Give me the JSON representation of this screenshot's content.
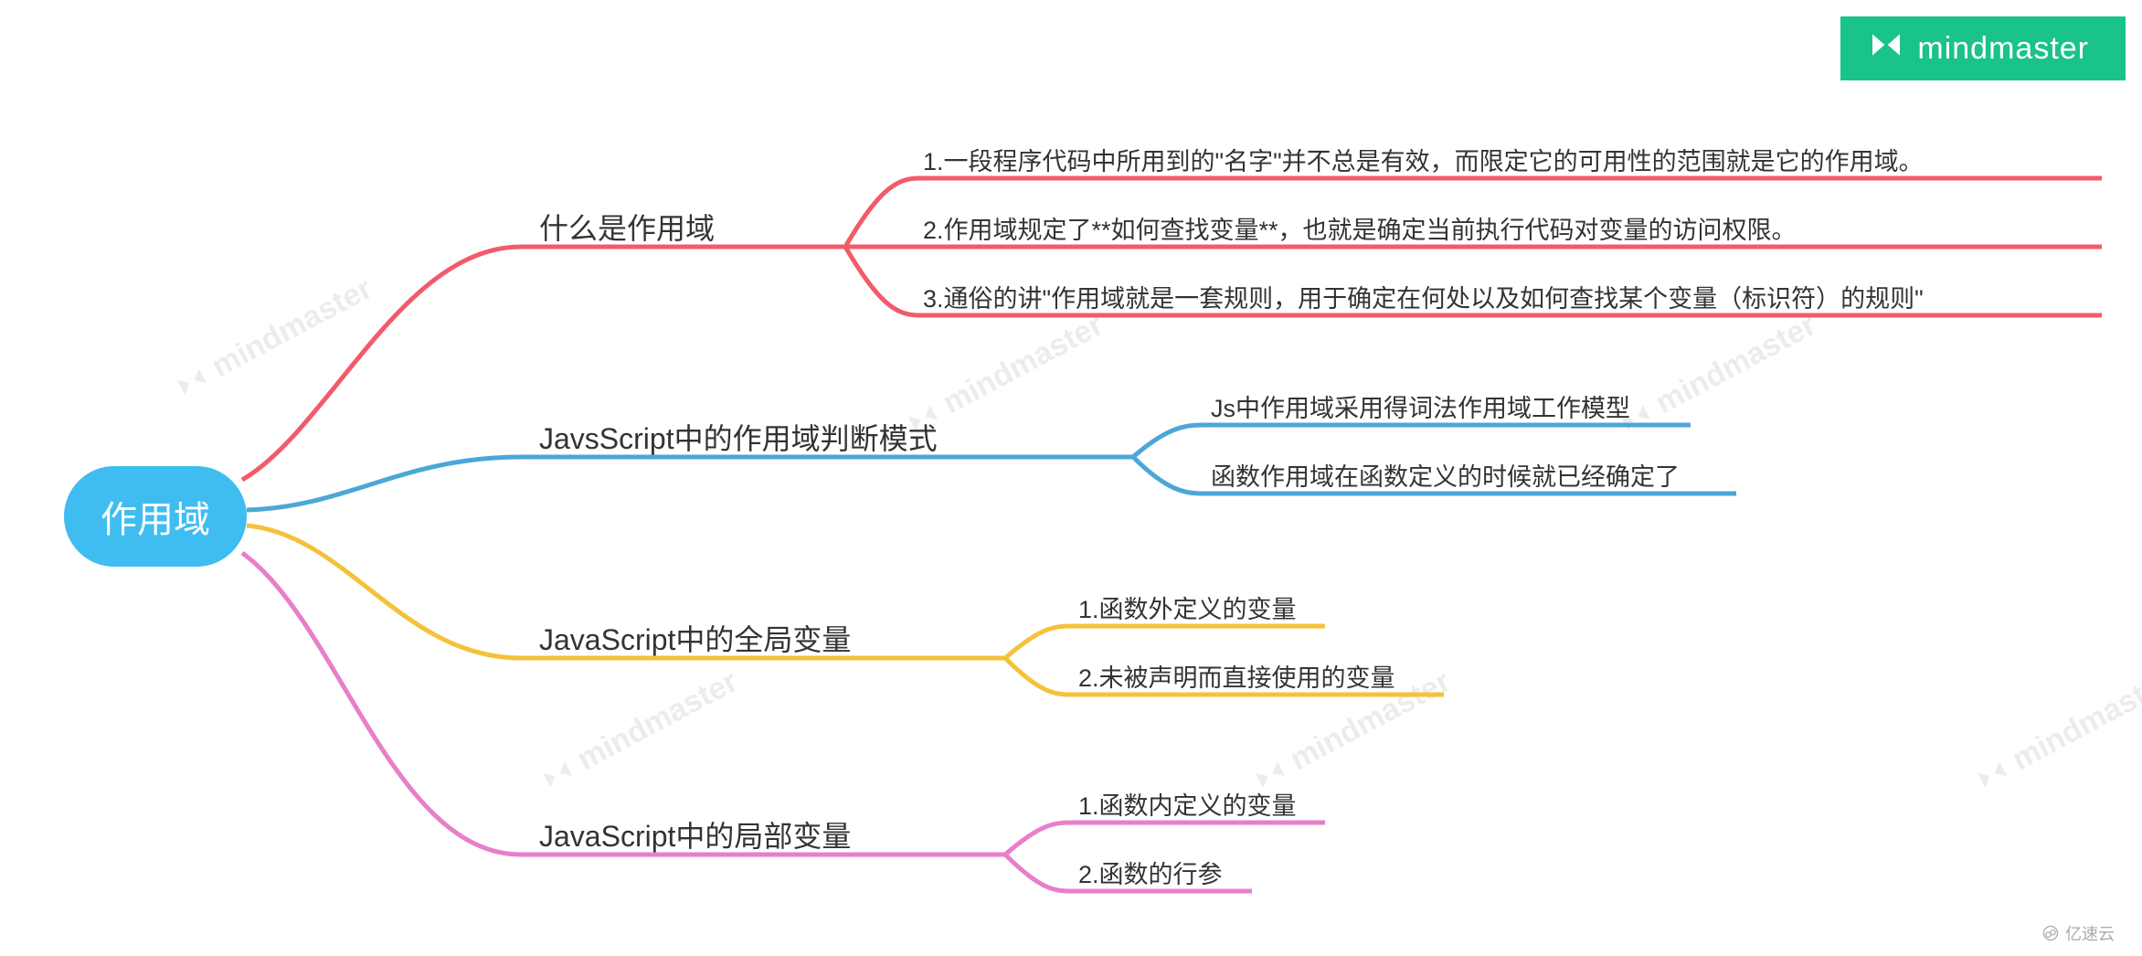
{
  "brand": {
    "name": "mindmaster",
    "watermark": "mindmaster",
    "footer": "亿速云"
  },
  "colors": {
    "root_bg": "#3FBDF1",
    "branch1": "#F25B6A",
    "branch2": "#4BA7D6",
    "branch3": "#F4C23A",
    "branch4": "#E77FC9",
    "badge_bg": "#19C38A"
  },
  "mindmap": {
    "root": "作用域",
    "branches": [
      {
        "id": "b1",
        "label": "什么是作用域",
        "children": [
          "1.一段程序代码中所用到的\"名字\"并不总是有效，而限定它的可用性的范围就是它的作用域。",
          "2.作用域规定了**如何查找变量**，也就是确定当前执行代码对变量的访问权限。",
          "3.通俗的讲\"作用域就是一套规则，用于确定在何处以及如何查找某个变量（标识符）的规则\""
        ]
      },
      {
        "id": "b2",
        "label": "JavsScript中的作用域判断模式",
        "children": [
          "Js中作用域采用得词法作用域工作模型",
          "函数作用域在函数定义的时候就已经确定了"
        ]
      },
      {
        "id": "b3",
        "label": "JavaScript中的全局变量",
        "children": [
          "1.函数外定义的变量",
          "2.未被声明而直接使用的变量"
        ]
      },
      {
        "id": "b4",
        "label": "JavaScript中的局部变量",
        "children": [
          "1.函数内定义的变量",
          "2.函数的行参"
        ]
      }
    ]
  },
  "chart_data": {
    "type": "table",
    "title": "作用域",
    "series": [
      {
        "name": "什么是作用域",
        "values": [
          "1.一段程序代码中所用到的\"名字\"并不总是有效，而限定它的可用性的范围就是它的作用域。",
          "2.作用域规定了**如何查找变量**，也就是确定当前执行代码对变量的访问权限。",
          "3.通俗的讲\"作用域就是一套规则，用于确定在何处以及如何查找某个变量（标识符）的规则\""
        ]
      },
      {
        "name": "JavsScript中的作用域判断模式",
        "values": [
          "Js中作用域采用得词法作用域工作模型",
          "函数作用域在函数定义的时候就已经确定了"
        ]
      },
      {
        "name": "JavaScript中的全局变量",
        "values": [
          "1.函数外定义的变量",
          "2.未被声明而直接使用的变量"
        ]
      },
      {
        "name": "JavaScript中的局部变量",
        "values": [
          "1.函数内定义的变量",
          "2.函数的行参"
        ]
      }
    ]
  }
}
